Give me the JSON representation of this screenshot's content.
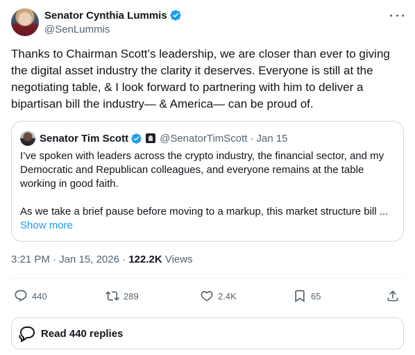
{
  "author": {
    "name": "Senator Cynthia Lummis",
    "handle": "@SenLummis"
  },
  "tweet": {
    "text": "Thanks to Chairman Scott’s leadership, we are closer than ever to giving the digital asset industry the clarity it deserves. Everyone is still at the negotiating table, & I look forward to partnering with him to deliver a bipartisan bill the industry— & America— can be proud of."
  },
  "quote": {
    "name": "Senator Tim Scott",
    "handle": "@SenatorTimScott",
    "separator": "·",
    "date": "Jan 15",
    "paragraph1": "I’ve spoken with leaders across the crypto industry, the financial sector, and my Democratic and Republican colleagues, and everyone remains at the table working in good faith.",
    "paragraph2": "As we take a brief pause before moving to a markup, this market structure bill ...",
    "show_more": "Show more"
  },
  "meta": {
    "time": "3:21 PM",
    "sep": "·",
    "date": "Jan 15, 2026",
    "views_count": "122.2K",
    "views_label": "Views"
  },
  "actions": {
    "replies": "440",
    "reposts": "289",
    "likes": "2.4K",
    "bookmarks": "65"
  },
  "read_replies": "Read 440 replies",
  "colors": {
    "verified": "#1d9bf0",
    "link": "#1d9bf0",
    "muted": "#536471",
    "border": "#cfd9de"
  },
  "icons": [
    "verified-badge-icon",
    "more-icon",
    "reply-icon",
    "repost-icon",
    "like-icon",
    "bookmark-icon",
    "share-icon",
    "replies-bubble-icon",
    "government-org-icon"
  ]
}
